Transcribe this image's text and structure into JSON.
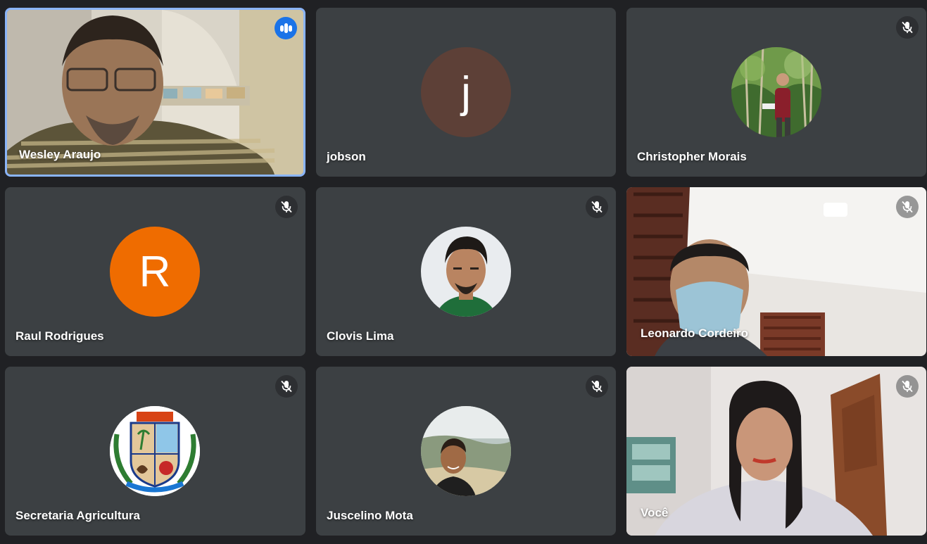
{
  "participants": [
    {
      "name": "Wesley Araujo",
      "state": "speaking"
    },
    {
      "name": "jobson",
      "avatar_letter": "j",
      "avatar_color": "#5d4037",
      "state": "unmuted"
    },
    {
      "name": "Christopher Morais",
      "state": "muted"
    },
    {
      "name": "Raul Rodrigues",
      "avatar_letter": "R",
      "avatar_color": "#ef6c00",
      "state": "muted"
    },
    {
      "name": "Clovis Lima",
      "state": "muted"
    },
    {
      "name": "Leonardo Cordeiro",
      "state": "muted"
    },
    {
      "name": "Secretaria Agricultura",
      "state": "muted"
    },
    {
      "name": "Juscelino Mota",
      "state": "muted"
    },
    {
      "name": "Você",
      "state": "muted"
    }
  ],
  "colors": {
    "background": "#202124",
    "tile": "#3c4043",
    "speaking_border": "#8ab4f8",
    "speaking_badge": "#1a73e8"
  },
  "icons": {
    "muted": "mic-off-icon",
    "speaking": "audio-level-icon"
  }
}
